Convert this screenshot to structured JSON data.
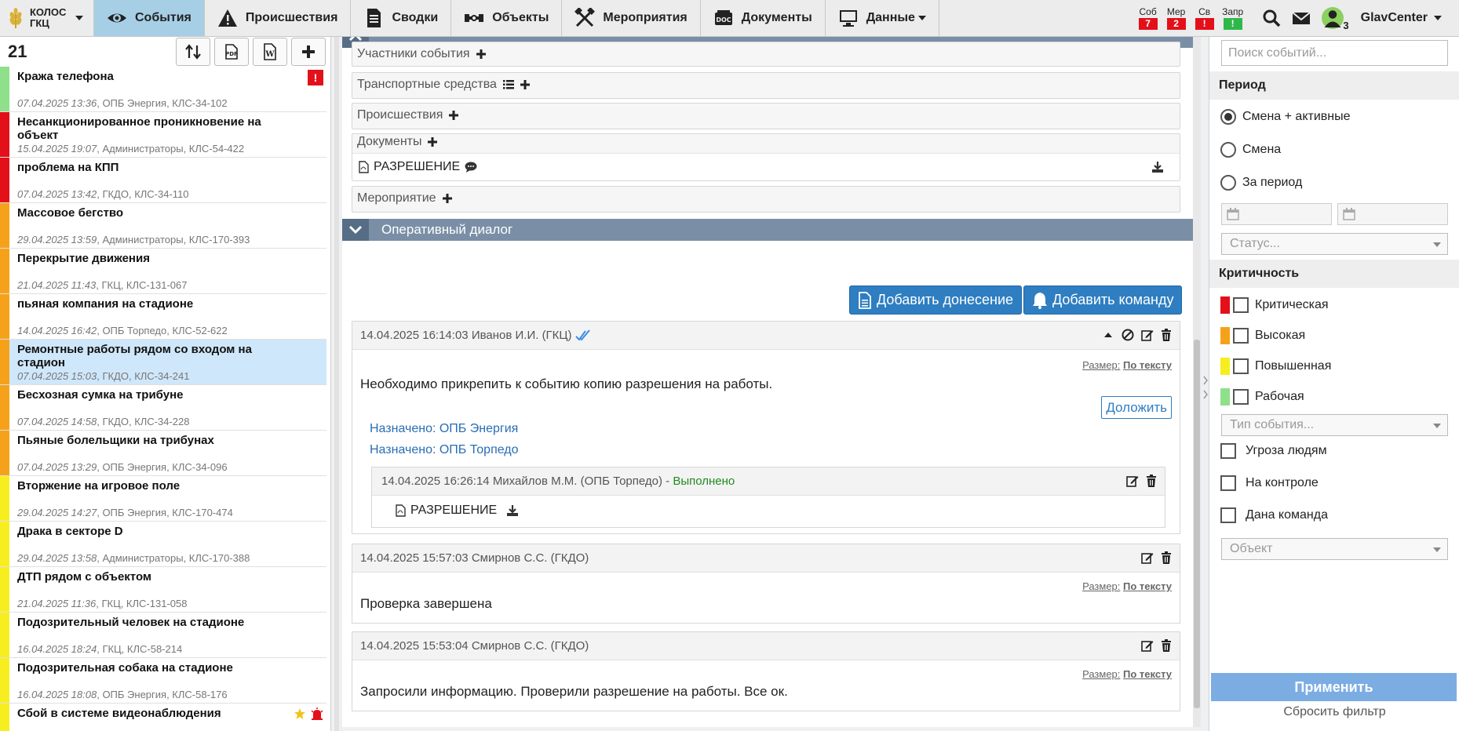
{
  "brand": {
    "line1": "КОЛОС",
    "line2": "ГКЦ"
  },
  "nav": [
    {
      "label": "События",
      "icon": "eye-icon",
      "active": true
    },
    {
      "label": "Происшествия",
      "icon": "warning-icon"
    },
    {
      "label": "Сводки",
      "icon": "document-icon"
    },
    {
      "label": "Объекты",
      "icon": "cctv-icon"
    },
    {
      "label": "Мероприятия",
      "icon": "crossed-tools-icon"
    },
    {
      "label": "Документы",
      "icon": "doc-folder-icon"
    },
    {
      "label": "Данные",
      "icon": "monitor-icon"
    }
  ],
  "counters": [
    {
      "label": "Соб",
      "value": "7",
      "color": "#e3101a"
    },
    {
      "label": "Мер",
      "value": "2",
      "color": "#e3101a"
    },
    {
      "label": "Св",
      "value": "!",
      "color": "#e3101a"
    },
    {
      "label": "Запр",
      "value": "!",
      "color": "#2fb84a"
    }
  ],
  "user": {
    "name": "GlavCenter",
    "online_count": "3"
  },
  "events_panel": {
    "count": "21",
    "events": [
      {
        "title": "Кража телефона",
        "date": "07.04.2025 13:36",
        "meta": ", ОПБ Энергия, КЛС-34-102",
        "color": "#8fe08a",
        "flag": "!"
      },
      {
        "title": "Несанкционированное проникновение на объект",
        "date": "15.04.2025 19:07",
        "meta": ", Администраторы, КЛС-54-422",
        "color": "#e3101a"
      },
      {
        "title": "проблема на КПП",
        "date": "07.04.2025 13:42",
        "meta": ", ГКДО, КЛС-34-110",
        "color": "#e3101a"
      },
      {
        "title": "Массовое бегство",
        "date": "29.04.2025 13:59",
        "meta": ", Администраторы, КЛС-170-393",
        "color": "#f5a21a"
      },
      {
        "title": "Перекрытие движения",
        "date": "21.04.2025 11:43",
        "meta": ", ГКЦ, КЛС-131-067",
        "color": "#f5a21a"
      },
      {
        "title": "пьяная компания на стадионе",
        "date": "14.04.2025 16:42",
        "meta": ", ОПБ Торпедо, КЛС-52-622",
        "color": "#f5a21a"
      },
      {
        "title": "Ремонтные работы рядом со входом на стадион",
        "date": "07.04.2025 15:03",
        "meta": ", ГКДО, КЛС-34-241",
        "color": "#f5a21a",
        "selected": true
      },
      {
        "title": "Бесхозная сумка на трибуне",
        "date": "07.04.2025 14:58",
        "meta": ", ГКДО, КЛС-34-228",
        "color": "#f5a21a"
      },
      {
        "title": "Пьяные болельщики на трибунах",
        "date": "07.04.2025 13:29",
        "meta": ", ОПБ Энергия, КЛС-34-096",
        "color": "#f5a21a"
      },
      {
        "title": "Вторжение на игровое поле",
        "date": "29.04.2025 14:27",
        "meta": ", ОПБ Энергия, КЛС-170-474",
        "color": "#f7ee1f"
      },
      {
        "title": "Драка в секторе D",
        "date": "29.04.2025 13:58",
        "meta": ", Администраторы, КЛС-170-388",
        "color": "#f7ee1f"
      },
      {
        "title": "ДТП рядом с объектом",
        "date": "21.04.2025 11:36",
        "meta": ", ГКЦ, КЛС-131-058",
        "color": "#f7ee1f"
      },
      {
        "title": "Подозрительный человек на стадионе",
        "date": "16.04.2025 18:24",
        "meta": ", ГКЦ, КЛС-58-214",
        "color": "#f7ee1f"
      },
      {
        "title": "Подозрительная собака на стадионе",
        "date": "16.04.2025 18:08",
        "meta": ", ОПБ Энергия, КЛС-58-176",
        "color": "#f7ee1f"
      },
      {
        "title": "Сбой в системе видеонаблюдения",
        "date": "",
        "meta": "",
        "color": "#f7ee1f",
        "icons": [
          "star-icon",
          "alarm-icon"
        ]
      }
    ]
  },
  "details": {
    "participants": "Участники события",
    "vehicles": "Транспортные средства",
    "incidents": "Происшествия",
    "documents": "Документы",
    "doc_name": "РАЗРЕШЕНИЕ",
    "activity": "Мероприятие"
  },
  "dialog": {
    "title": "Оперативный диалог",
    "add_report": "Добавить донесение",
    "add_command": "Добавить команду",
    "size_label": "Размер:",
    "size_value": "По тексту",
    "messages": [
      {
        "timestamp": "14.04.2025 16:14:03",
        "author": "Иванов И.И. (ГКЦ)",
        "text": "Необходимо прикрепить к событию копию разрешения на работы.",
        "report_button": "Доложить",
        "assigned": [
          "Назначено: ОПБ Энергия",
          "Назначено: ОПБ Торпедо"
        ],
        "reply": {
          "timestamp": "14.04.2025 16:26:14",
          "author": "Михайлов М.М. (ОПБ Торпедо) -",
          "status": "Выполнено",
          "attachment": "РАЗРЕШЕНИЕ"
        }
      },
      {
        "timestamp": "14.04.2025 15:57:03",
        "author": "Смирнов С.С. (ГКДО)",
        "text": "Проверка завершена"
      },
      {
        "timestamp": "14.04.2025 15:53:04",
        "author": "Смирнов С.С. (ГКДО)",
        "text": "Запросили информацию. Проверили разрешение на работы. Все ок."
      }
    ]
  },
  "filters": {
    "search_placeholder": "Поиск событий...",
    "period_title": "Период",
    "period_options": [
      "Смена + активные",
      "Смена",
      "За период"
    ],
    "period_selected": 0,
    "status_placeholder": "Статус...",
    "criticality_title": "Критичность",
    "criticality": [
      {
        "label": "Критическая",
        "color": "#e3101a"
      },
      {
        "label": "Высокая",
        "color": "#f5a21a"
      },
      {
        "label": "Повышенная",
        "color": "#f7ee1f"
      },
      {
        "label": "Рабочая",
        "color": "#8fe08a"
      }
    ],
    "event_type_placeholder": "Тип события...",
    "checkboxes": [
      "Угроза людям",
      "На контроле",
      "Дана команда"
    ],
    "object_placeholder": "Объект",
    "apply": "Применить",
    "reset": "Сбросить фильтр"
  }
}
